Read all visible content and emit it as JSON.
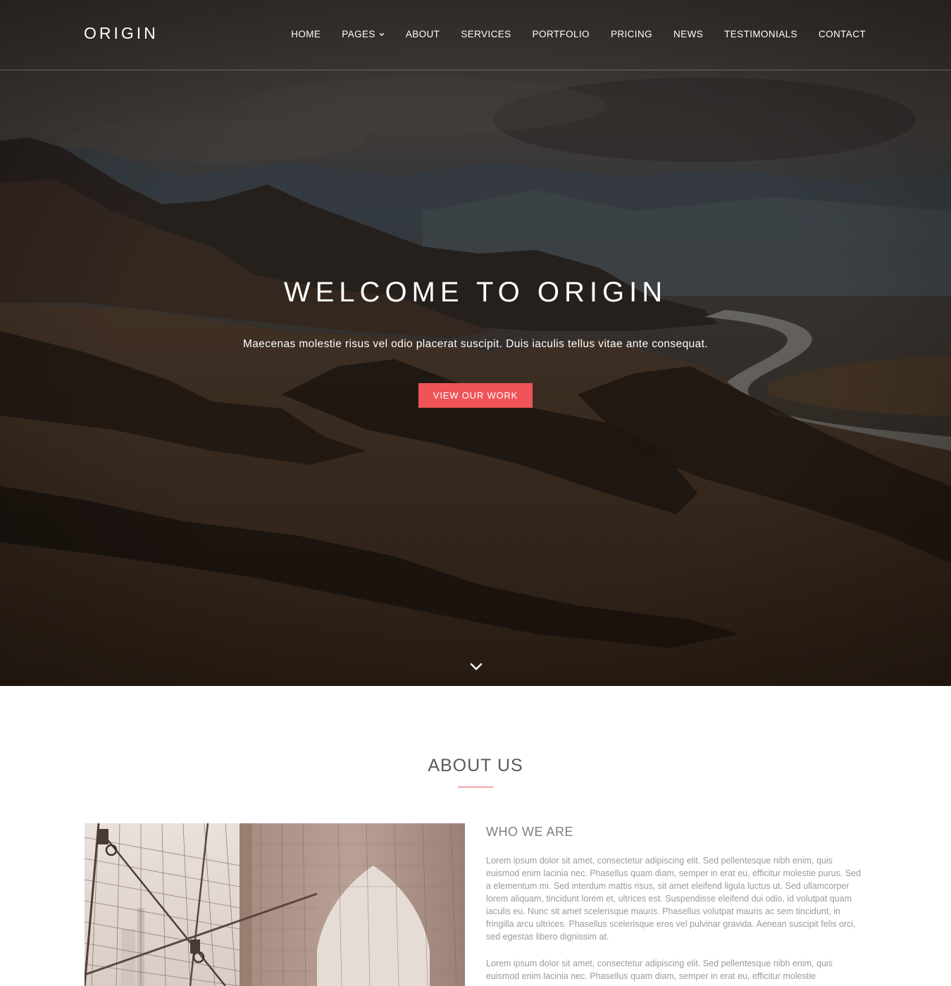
{
  "brand": {
    "logo": "ORIGIN"
  },
  "nav": {
    "items": [
      {
        "label": "HOME"
      },
      {
        "label": "PAGES",
        "has_dropdown": true
      },
      {
        "label": "ABOUT"
      },
      {
        "label": "SERVICES"
      },
      {
        "label": "PORTFOLIO"
      },
      {
        "label": "PRICING"
      },
      {
        "label": "NEWS"
      },
      {
        "label": "TESTIMONIALS"
      },
      {
        "label": "CONTACT"
      }
    ],
    "dropdown_icon": "chevron-down-icon"
  },
  "hero": {
    "title": "WELCOME TO ORIGIN",
    "subtitle": "Maecenas molestie risus vel odio placerat suscipit. Duis iaculis tellus vitae ante consequat.",
    "cta_label": "VIEW OUR WORK",
    "scroll_icon": "chevron-down-icon"
  },
  "about": {
    "title": "ABOUT US",
    "subtitle": "WHO WE ARE",
    "paragraphs": [
      "Lorem ipsum dolor sit amet, consectetur adipiscing elit. Sed pellentesque nibh enim, quis euismod enim lacinia nec. Phasellus quam diam, semper in erat eu, efficitur molestie purus. Sed a elementum mi. Sed interdum mattis risus, sit amet eleifend ligula luctus ut. Sed ullamcorper lorem aliquam, tincidunt lorem et, ultrices est. Suspendisse eleifend dui odio, id volutpat quam iaculis eu. Nunc sit amet scelerisque mauris. Phasellus volutpat mauris ac sem tincidunt, in fringilla arcu ultrices. Phasellus scelerisque eros vel pulvinar gravida. Aenean suscipit felis orci, sed egestas libero dignissim at.",
      "Lorem ipsum dolor sit amet, consectetur adipiscing elit. Sed pellentesque nibh enim, quis euismod enim lacinia nec. Phasellus quam diam, semper in erat eu, efficitur molestie"
    ]
  },
  "colors": {
    "accent": "#ef5459",
    "hero_overlay": "#2a211b",
    "text_muted": "#9a9a9a"
  }
}
